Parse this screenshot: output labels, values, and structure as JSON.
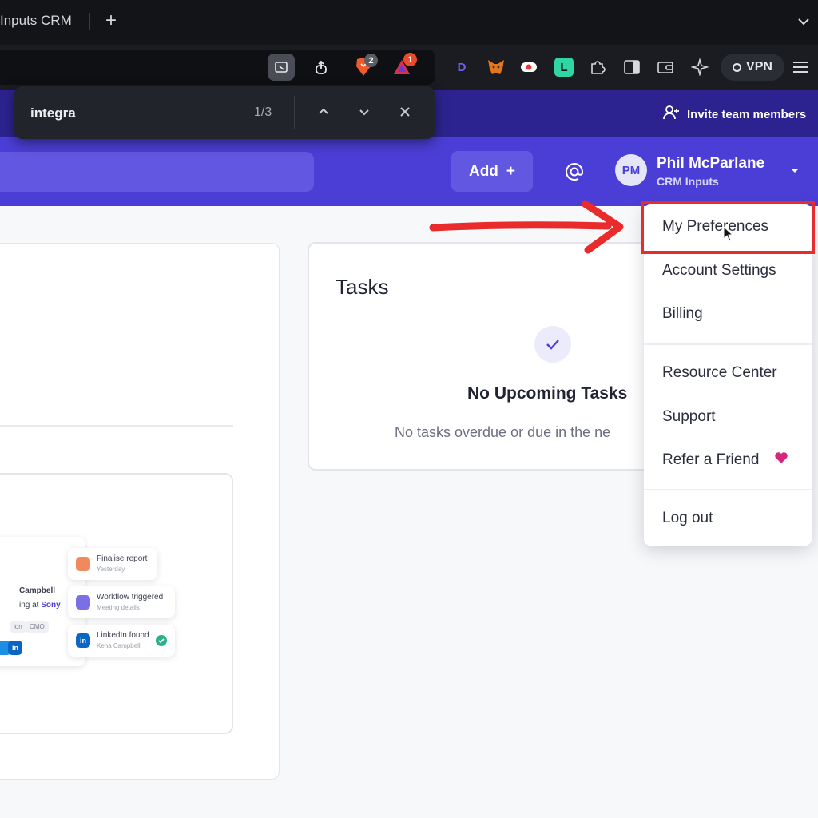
{
  "browser": {
    "tab_title": "Inputs CRM",
    "new_tab_symbol": "+",
    "extension_badges": {
      "brave": "2",
      "rewards": "1"
    },
    "extensions": [
      "D",
      "L"
    ],
    "vpn_label": "VPN"
  },
  "find_bar": {
    "query": "integra",
    "match_count": "1/3"
  },
  "header": {
    "invite_label": "Invite team members",
    "add_label": "Add",
    "add_symbol": "+",
    "user_initials": "PM",
    "user_name": "Phil McParlane",
    "user_org": "CRM Inputs"
  },
  "illustration": {
    "contact_name": "Campbell",
    "contact_prefix": "ing at ",
    "contact_company": "Sony",
    "chips": [
      "ion",
      "CMO"
    ],
    "activities": [
      {
        "title": "Finalise report",
        "sub": "Yesterday"
      },
      {
        "title": "Workflow triggered",
        "sub": "Meeting details"
      },
      {
        "title": "LinkedIn found",
        "sub": "Kena Campbell"
      }
    ],
    "linkedin_glyph": "in"
  },
  "tasks": {
    "title": "Tasks",
    "empty_title": "No Upcoming Tasks",
    "empty_subtitle": "No tasks overdue or due in the ne"
  },
  "user_menu": {
    "items": [
      {
        "label": "My Preferences"
      },
      {
        "label": "Account Settings"
      },
      {
        "label": "Billing"
      },
      {
        "label": "Resource Center"
      },
      {
        "label": "Support"
      },
      {
        "label": "Refer a Friend"
      },
      {
        "label": "Log out"
      }
    ]
  },
  "colors": {
    "brand_primary": "#4b3ed6",
    "brand_dark": "#2d2390",
    "annotation_red": "#ea2b2b",
    "heart": "#d6267c"
  }
}
